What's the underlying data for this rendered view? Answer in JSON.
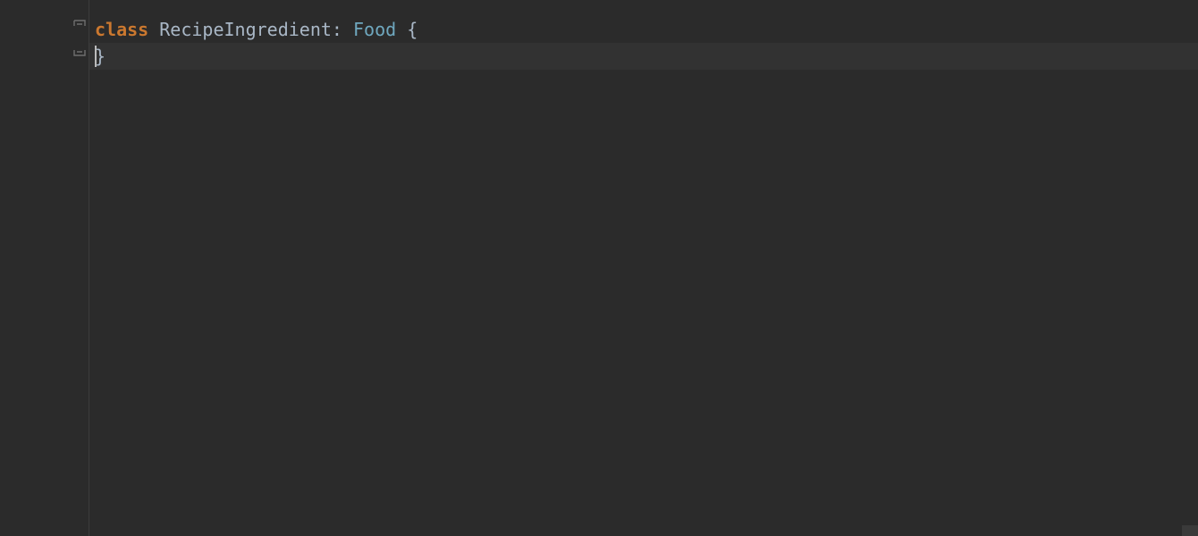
{
  "editor": {
    "lines": [
      {
        "tokens": {
          "keyword": "class",
          "space1": " ",
          "className": "RecipeIngredient",
          "colon": ":",
          "space2": " ",
          "superType": "Food",
          "space3": " ",
          "openBrace": "{"
        }
      },
      {
        "closeBrace": "}"
      }
    ]
  },
  "icons": {
    "override": "override-down-icon",
    "foldOpen": "fold-open-icon",
    "foldClose": "fold-close-icon"
  }
}
